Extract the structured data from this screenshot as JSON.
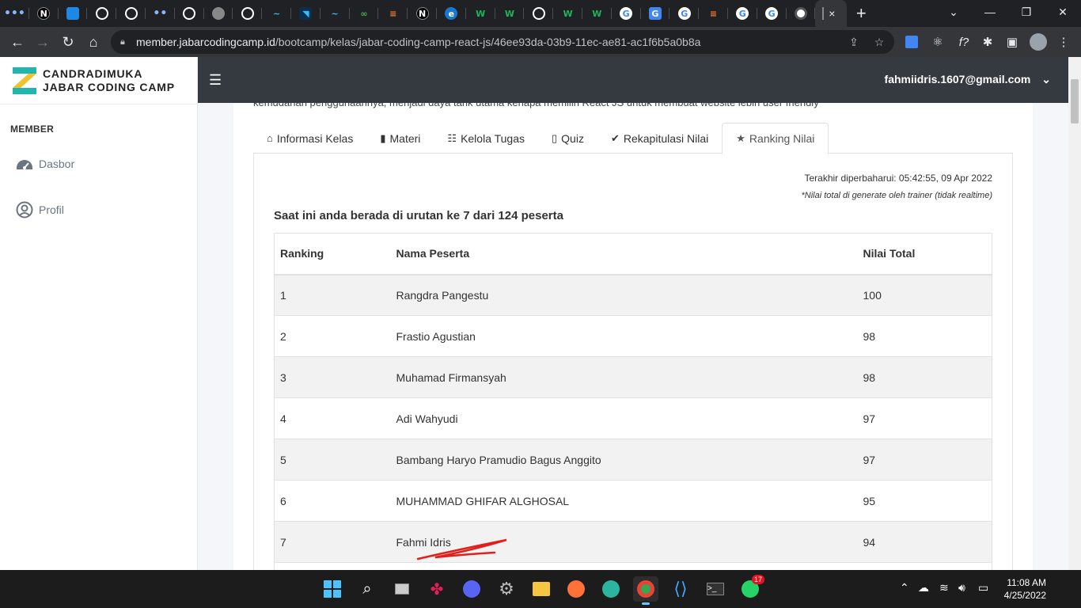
{
  "browser": {
    "active_tab_close": "×",
    "new_tab": "+",
    "url_host": "member.jabarcodingcamp.id",
    "url_path": "/bootcamp/kelas/jabar-coding-camp-react-js/46ee93da-03b9-11ec-ae81-ac1f6b5a0b8a"
  },
  "sidebar": {
    "brand_line1": "CANDRADIMUKA",
    "brand_line2": "JABAR CODING CAMP",
    "section_header": "MEMBER",
    "items": [
      {
        "label": "Dasbor",
        "icon": "speedometer-icon"
      },
      {
        "label": "Profil",
        "icon": "user-circle-icon"
      }
    ]
  },
  "topbar": {
    "user_email": "fahmiidris.1607@gmail.com"
  },
  "content": {
    "cut_text": "kemudahan penggunaannya, menjadi daya tarik utama kenapa memilih React JS untuk membuat website lebih user friendly",
    "tabs": [
      {
        "label": "Informasi Kelas",
        "icon": "home-icon"
      },
      {
        "label": "Materi",
        "icon": "book-icon"
      },
      {
        "label": "Kelola Tugas",
        "icon": "tasks-icon"
      },
      {
        "label": "Quiz",
        "icon": "file-icon"
      },
      {
        "label": "Rekapitulasi Nilai",
        "icon": "clipboard-check-icon"
      },
      {
        "label": "Ranking Nilai",
        "icon": "star-icon"
      }
    ],
    "last_updated": "Terakhir diperbaharui: 05:42:55, 09 Apr 2022",
    "note": "*Nilai total di generate oleh trainer (tidak realtime)",
    "rank_info": "Saat ini anda berada di urutan ke 7 dari 124 peserta",
    "table": {
      "headers": [
        "Ranking",
        "Nama Peserta",
        "Nilai Total"
      ],
      "rows": [
        [
          "1",
          "Rangdra Pangestu",
          "100"
        ],
        [
          "2",
          "Frastio Agustian",
          "98"
        ],
        [
          "3",
          "Muhamad Firmansyah",
          "98"
        ],
        [
          "4",
          "Adi Wahyudi",
          "97"
        ],
        [
          "5",
          "Bambang Haryo Pramudio Bagus Anggito",
          "97"
        ],
        [
          "6",
          "MUHAMMAD GHIFAR ALGHOSAL",
          "95"
        ],
        [
          "7",
          "Fahmi Idris",
          "94"
        ]
      ]
    }
  },
  "taskbar": {
    "time": "11:08 AM",
    "date": "4/25/2022",
    "whatsapp_badge": "17"
  },
  "colors": {
    "topbar": "#343a40",
    "brand_teal": "#1fb6b0",
    "brand_yellow": "#f2c12e",
    "scribble": "#e0201b"
  }
}
